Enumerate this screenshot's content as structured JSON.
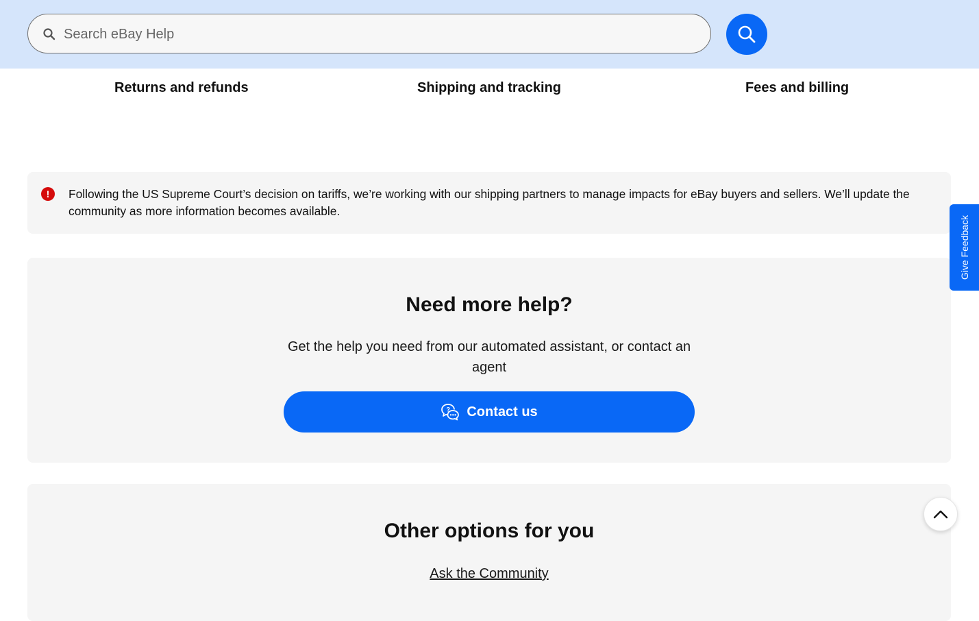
{
  "search": {
    "placeholder": "Search eBay Help",
    "button_icon": "search-icon"
  },
  "categories": [
    {
      "label": "Returns and refunds"
    },
    {
      "label": "Shipping and tracking"
    },
    {
      "label": "Fees and billing"
    }
  ],
  "notice": {
    "icon": "alert-icon",
    "text": "Following the US Supreme Court’s decision on tariffs, we’re working with our shipping partners to manage impacts for eBay buyers and sellers. We’ll update the community as more information becomes available."
  },
  "help": {
    "title": "Need more help?",
    "subtitle": "Get the help you need from our automated assistant, or contact an agent",
    "contact_label": "Contact us",
    "contact_icon": "chat-bubbles-icon"
  },
  "options": {
    "title": "Other options for you",
    "ask_community": "Ask the Community"
  },
  "feedback": {
    "label": "Give Feedback"
  },
  "scroll_top": {
    "icon": "chevron-up-icon"
  },
  "colors": {
    "accent": "#0968f6",
    "search_band": "#d5e5fb",
    "card_bg": "#f5f5f5",
    "alert": "#d50b0b"
  }
}
